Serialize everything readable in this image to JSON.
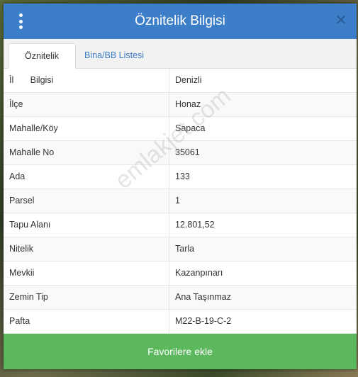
{
  "header": {
    "title": "Öznitelik Bilgisi",
    "menu_icon": "kebab-menu-icon",
    "close_icon": "close-icon",
    "accent": "#3d7ec8"
  },
  "tabs": [
    {
      "label": "Öznitelik Bilgisi",
      "active": true
    },
    {
      "label": "Bina/BB Listesi",
      "active": false
    }
  ],
  "attributes": [
    {
      "key": "İl",
      "value": "Denizli"
    },
    {
      "key": "İlçe",
      "value": "Honaz"
    },
    {
      "key": "Mahalle/Köy",
      "value": "Sapaca"
    },
    {
      "key": "Mahalle No",
      "value": "35061"
    },
    {
      "key": "Ada",
      "value": "133"
    },
    {
      "key": "Parsel",
      "value": "1"
    },
    {
      "key": "Tapu Alanı",
      "value": "12.801,52"
    },
    {
      "key": "Nitelik",
      "value": "Tarla"
    },
    {
      "key": "Mevkii",
      "value": "Kazanpınarı"
    },
    {
      "key": "Zemin Tip",
      "value": "Ana Taşınmaz"
    },
    {
      "key": "Pafta",
      "value": "M22-B-19-C-2"
    }
  ],
  "footer": {
    "favorite_label": "Favorilere ekle",
    "button_color": "#5cb85c"
  },
  "watermark": "emlakjet.com"
}
